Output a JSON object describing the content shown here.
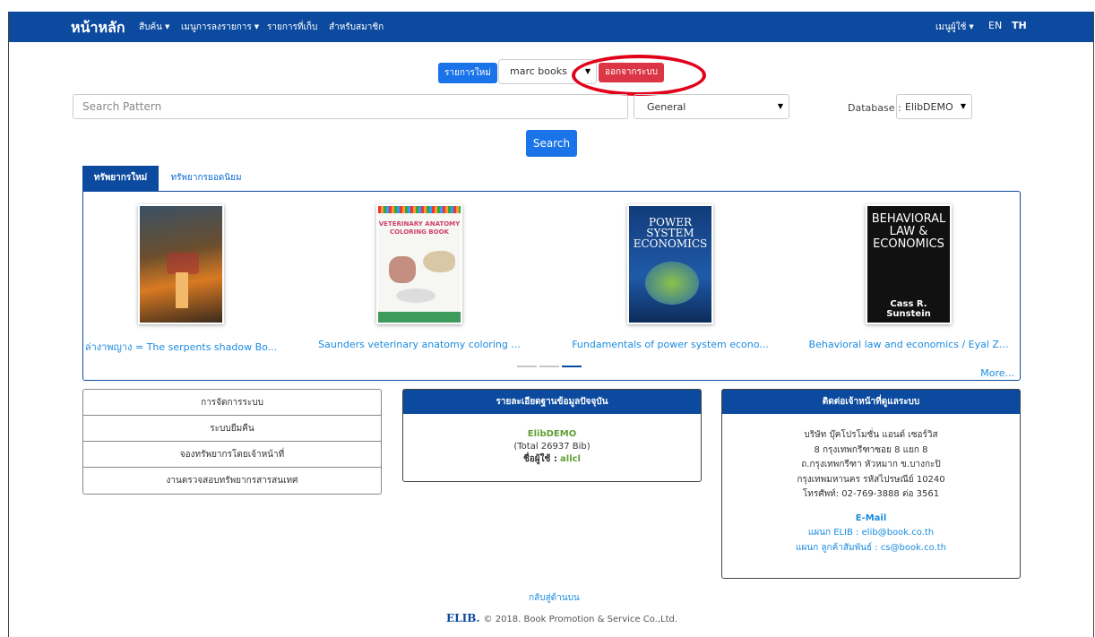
{
  "navbar": {
    "brand": "หน้าหลัก",
    "items": [
      "สืบค้น",
      "เมนูการลงรายการ",
      "รายการที่เก็บ",
      "สำหรับสมาชิก"
    ],
    "user_menu": "เมนูผู้ใช้",
    "lang_en": "EN",
    "lang_th": "TH",
    "color": "#0b4a9e"
  },
  "toolbar": {
    "new_button": "รายการใหม่",
    "user_select": "marc books",
    "logout_button": "ออกจากระบบ"
  },
  "search": {
    "placeholder": "Search Pattern",
    "field_select": "General",
    "database_label": "Database :",
    "database_select": "ElibDEMO",
    "search_button": "Search"
  },
  "tabs": [
    "ทรัพยากรใหม่",
    "ทรัพยากรยอดนิยม"
  ],
  "books": [
    {
      "title": "ล่างาพญาง = The serpents shadow Bo...",
      "cover_text": ""
    },
    {
      "title": "Saunders veterinary anatomy coloring ...",
      "cover_text": "VETERINARY ANATOMY COLORING BOOK"
    },
    {
      "title": "Fundamentals of power system econo...",
      "cover_text": "POWER SYSTEM ECONOMICS"
    },
    {
      "title": "Behavioral law and economics / Eyal Z...",
      "cover_text": "BEHAVIORAL LAW & ECONOMICS",
      "cover_author": "Cass R. Sunstein"
    }
  ],
  "carousel_more": "More...",
  "admin_menu": [
    "การจัดการระบบ",
    "ระบบยืมคืน",
    "จองทรัพยากรโดยเจ้าหน้าที่",
    "งานตรวจสอบทรัพยากรสารสนเทศ"
  ],
  "db_card": {
    "title": "รายละเอียดฐานข้อมูลปัจจุบัน",
    "db_name": "ElibDEMO",
    "total": "(Total 26937 Bib)",
    "user_label": "ชื่อผู้ใช้ :",
    "user_value": "allcl"
  },
  "contact_card": {
    "title": "ติดต่อเจ้าหน้าที่ดูแลระบบ",
    "lines": [
      "บริษัท บุ๊คโปรโมชั่น แอนด์ เซอร์วิส",
      "8 กรุงเทพกรีฑาซอย 8 แยก 8",
      "ถ.กรุงเทพกรีฑา หัวหมาก ข.บางกะปิ",
      "กรุงเทพมหานคร รหัสไปรษณีย์ 10240",
      "โทรศัพท์: 02-769-3888 ต่อ 3561"
    ],
    "email_heading": "E-Mail",
    "email_lines": [
      "แผนก ELIB : elib@book.co.th",
      "แผนก ลูกค้าสัมพันธ์ : cs@book.co.th"
    ]
  },
  "footer": {
    "back_to_top": "กลับสู่ด้านบน",
    "logo": "ELIB.",
    "copyright": "© 2018. Book Promotion & Service Co.,Ltd."
  }
}
